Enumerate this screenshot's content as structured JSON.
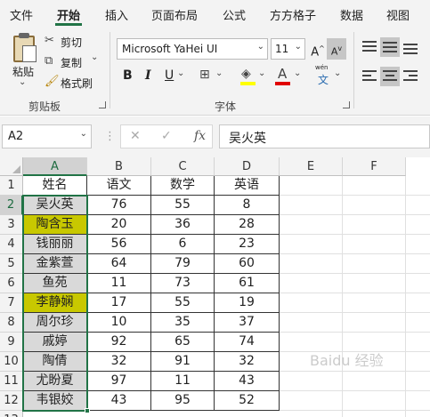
{
  "ribbon_tabs": [
    "文件",
    "开始",
    "插入",
    "页面布局",
    "公式",
    "方方格子",
    "数据",
    "视图"
  ],
  "clipboard": {
    "paste_label": "粘贴",
    "cut_label": "剪切",
    "copy_label": "复制",
    "format_painter_label": "格式刷",
    "group_title": "剪贴板"
  },
  "font": {
    "family": "Microsoft YaHei UI",
    "size": "11",
    "grow_icon": "A",
    "shrink_icon": "A",
    "bold_label": "B",
    "italic_label": "I",
    "underline_label": "U",
    "font_color_glyph": "A",
    "phonetic_label": "wén",
    "phonetic_glyph": "文",
    "group_title": "字体",
    "fill_color": "#ffff00",
    "font_color": "#e00000"
  },
  "formula_bar": {
    "name_box": "A2",
    "fx_label": "fx",
    "formula": "吴火英"
  },
  "columns": [
    "A",
    "B",
    "C",
    "D",
    "E",
    "F"
  ],
  "rows": [
    "1",
    "2",
    "3",
    "4",
    "5",
    "6",
    "7",
    "8",
    "9",
    "10",
    "11",
    "12",
    "13"
  ],
  "table": {
    "headers": [
      "姓名",
      "语文",
      "数学",
      "英语"
    ],
    "rows": [
      [
        "吴火英",
        "76",
        "55",
        "8"
      ],
      [
        "陶含玉",
        "20",
        "36",
        "28"
      ],
      [
        "钱丽丽",
        "56",
        "6",
        "23"
      ],
      [
        "金紫萱",
        "64",
        "79",
        "60"
      ],
      [
        "鱼苑",
        "11",
        "73",
        "61"
      ],
      [
        "李静娴",
        "17",
        "55",
        "19"
      ],
      [
        "周尔珍",
        "10",
        "35",
        "37"
      ],
      [
        "戚婷",
        "92",
        "65",
        "74"
      ],
      [
        "陶倩",
        "32",
        "91",
        "32"
      ],
      [
        "尤盼夏",
        "97",
        "11",
        "43"
      ],
      [
        "韦银姣",
        "43",
        "95",
        "52"
      ]
    ],
    "highlighted_rows": [
      1,
      5
    ],
    "highlight_color": "#c8c800",
    "name_fill_color": "#d9d9d9"
  },
  "watermark": "Baidu 经验"
}
